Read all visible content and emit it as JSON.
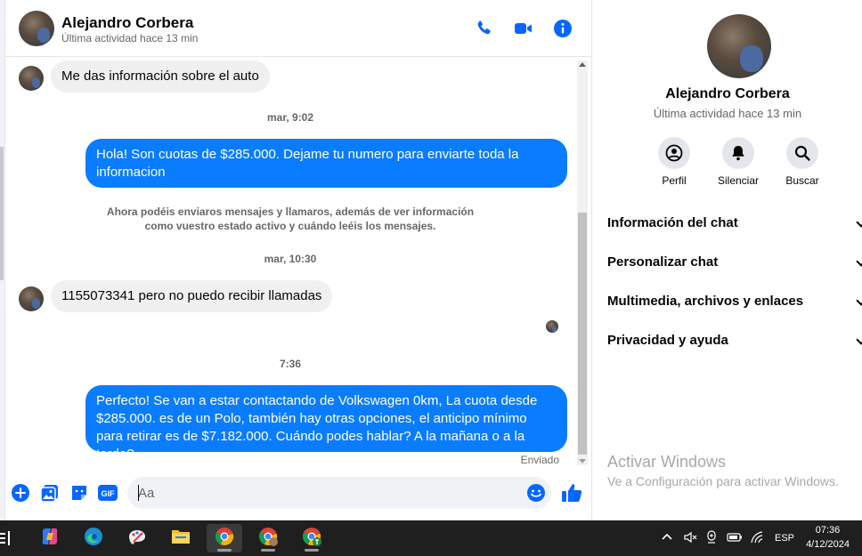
{
  "header": {
    "name": "Alejandro Corbera",
    "status": "Última actividad hace 13 min"
  },
  "messages": {
    "m1": "Me das información sobre el auto",
    "ts1": "mar, 9:02",
    "m2": "Hola! Son cuotas de $285.000. Dejame tu numero para enviarte toda la informacion",
    "sys": "Ahora podéis enviaros mensajes y llamaros, además de ver información como vuestro estado activo y cuándo leéis los mensajes.",
    "ts2": "mar, 10:30",
    "m3": "1155073341 pero no puedo recibir llamadas",
    "ts3": "7:36",
    "m4": "Perfecto!  Se van a estar contactando de Volkswagen 0km, La cuota desde $285.000. es de un Polo, también hay otras opciones, el anticipo mínimo para retirar es de $7.182.000. Cuándo podes hablar? A la mañana o a la tarde?",
    "sent": "Enviado"
  },
  "composer": {
    "placeholder": "Aa",
    "gif": "GIF"
  },
  "info": {
    "name": "Alejandro Corbera",
    "status": "Última actividad hace 13 min",
    "actions": [
      "Perfil",
      "Silenciar",
      "Buscar"
    ],
    "sections": [
      "Información del chat",
      "Personalizar chat",
      "Multimedia, archivos y enlaces",
      "Privacidad y ayuda"
    ]
  },
  "watermark": {
    "title": "Activar Windows",
    "subtitle": "Ve a Configuración para activar Windows."
  },
  "taskbar": {
    "language": "ESP",
    "time": "07:36",
    "date": "4/12/2024"
  },
  "colors": {
    "accent": "#0a7cff",
    "icon_blue": "#0866ff"
  }
}
